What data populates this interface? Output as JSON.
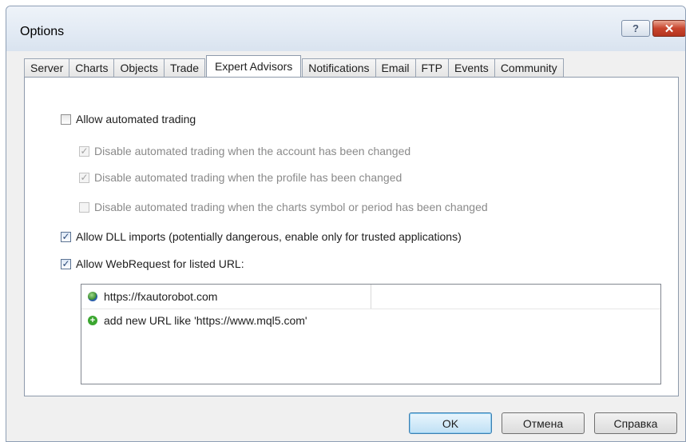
{
  "window": {
    "title": "Options",
    "help_label": "?",
    "close_label": "✕"
  },
  "tabs": [
    {
      "label": "Server",
      "active": false
    },
    {
      "label": "Charts",
      "active": false
    },
    {
      "label": "Objects",
      "active": false
    },
    {
      "label": "Trade",
      "active": false
    },
    {
      "label": "Expert Advisors",
      "active": true
    },
    {
      "label": "Notifications",
      "active": false
    },
    {
      "label": "Email",
      "active": false
    },
    {
      "label": "FTP",
      "active": false
    },
    {
      "label": "Events",
      "active": false
    },
    {
      "label": "Community",
      "active": false
    }
  ],
  "options": {
    "allow_automated": {
      "label": "Allow automated trading",
      "checked": false
    },
    "disable_account": {
      "label": "Disable automated trading when the account has been changed",
      "checked": true,
      "enabled": false
    },
    "disable_profile": {
      "label": "Disable automated trading when the profile has been changed",
      "checked": true,
      "enabled": false
    },
    "disable_symbol": {
      "label": "Disable automated trading when the charts symbol or period has been changed",
      "checked": false,
      "enabled": false
    },
    "allow_dll": {
      "label": "Allow DLL imports (potentially dangerous, enable only for trusted applications)",
      "checked": true
    },
    "allow_webrequest": {
      "label": "Allow WebRequest for listed URL:",
      "checked": true
    }
  },
  "url_list": {
    "items": [
      "https://fxautorobot.com"
    ],
    "add_placeholder": "add new URL like 'https://www.mql5.com'"
  },
  "buttons": {
    "ok": "OK",
    "cancel": "Отмена",
    "help": "Справка"
  }
}
